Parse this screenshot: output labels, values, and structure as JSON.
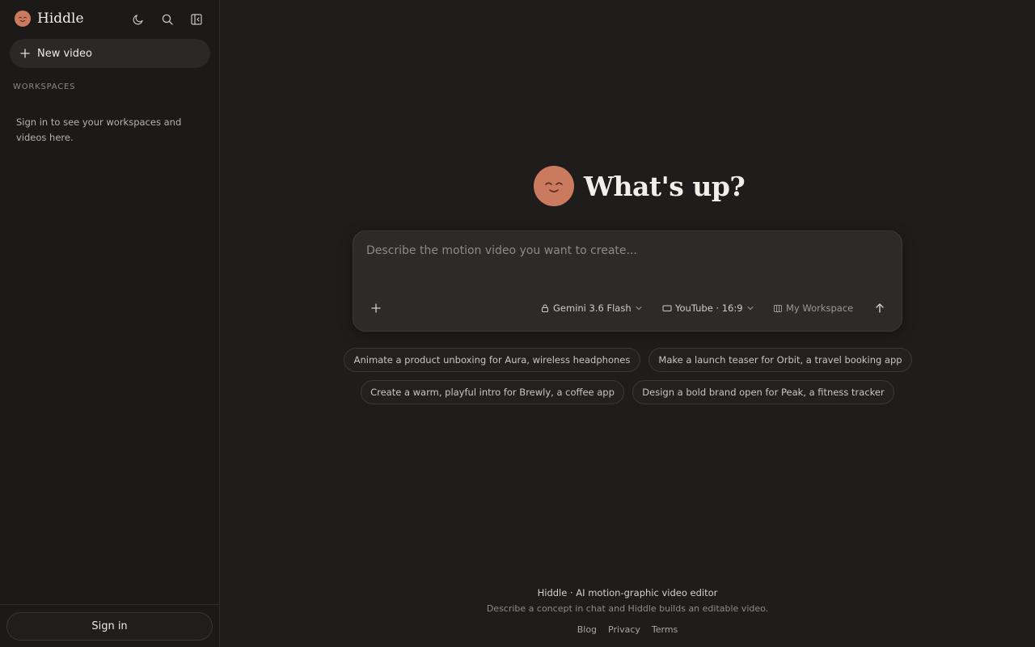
{
  "brand": {
    "name": "Hiddle",
    "accent": "#c97a5f"
  },
  "sidebar": {
    "new_video_label": "New video",
    "section_label": "WORKSPACES",
    "empty_message": "Sign in to see your workspaces and videos here.",
    "signin_label": "Sign in",
    "icons": [
      "moon-icon",
      "search-icon",
      "collapse-sidebar-icon"
    ]
  },
  "hero": {
    "title": "What's up?"
  },
  "composer": {
    "placeholder": "Describe the motion video you want to create...",
    "value": "",
    "model_label": "Gemini 3.6 Flash",
    "format_label": "YouTube · 16:9",
    "workspace_label": "My Workspace"
  },
  "suggestions": [
    "Animate a product unboxing for Aura, wireless headphones",
    "Make a launch teaser for Orbit, a travel booking app",
    "Create a warm, playful intro for Brewly, a coffee app",
    "Design a bold brand open for Peak, a fitness tracker"
  ],
  "footer": {
    "title": "Hiddle · AI motion-graphic video editor",
    "subtitle": "Describe a concept in chat and Hiddle builds an editable video.",
    "links": [
      "Blog",
      "Privacy",
      "Terms"
    ]
  }
}
